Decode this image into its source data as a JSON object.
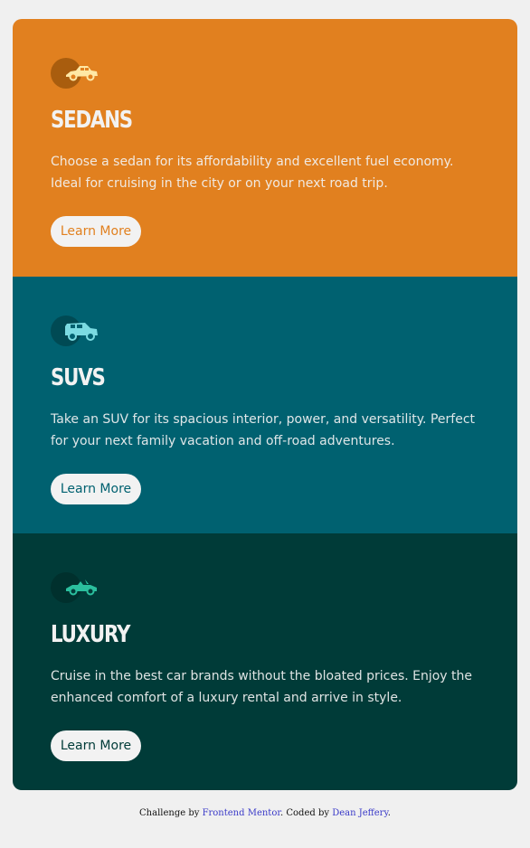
{
  "cards": [
    {
      "title": "Sedans",
      "description": "Choose a sedan for its affordability and excellent fuel economy. Ideal for cruising in the city or on your next road trip.",
      "button_label": "Learn More",
      "icon": "sedan-car-icon",
      "color": "#e1801f"
    },
    {
      "title": "SUVs",
      "description": "Take an SUV for its spacious interior, power, and versatility. Perfect for your next family vacation and off-road adventures.",
      "button_label": "Learn More",
      "icon": "suv-car-icon",
      "color": "#006170"
    },
    {
      "title": "Luxury",
      "description": "Cruise in the best car brands without the bloated prices. Enjoy the enhanced comfort of a luxury rental and arrive in style.",
      "button_label": "Learn More",
      "icon": "luxury-car-icon",
      "color": "#003b38"
    }
  ],
  "attribution": {
    "prefix": "Challenge by ",
    "challenge_link": "Frontend Mentor",
    "middle": ". Coded by ",
    "author_link": "Dean Jeffery",
    "suffix": "."
  }
}
